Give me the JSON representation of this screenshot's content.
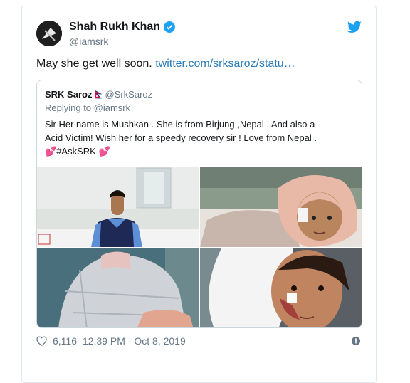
{
  "tweet": {
    "author_name": "Shah Rukh Khan",
    "author_handle": "@iamsrk",
    "text_prefix": "May she get well soon. ",
    "link_text": "twitter.com/srksaroz/statu…",
    "likes": "6,116",
    "timestamp": "12:39 PM - Oct 8, 2019",
    "icons": {
      "avatar": "profile-avatar",
      "verified": "verified-badge-icon",
      "brand": "twitter-bird-icon",
      "like": "heart-outline-icon",
      "info": "info-icon"
    },
    "colors": {
      "link": "#2b7bb9",
      "verified": "#1da1f2",
      "brand": "#1da1f2",
      "heart": "#e0245e"
    }
  },
  "quote": {
    "author_name": "SRK Saroz",
    "author_handle": "@SrkSaroz",
    "reply_prefix": "Replying to ",
    "reply_handle": "@iamsrk",
    "text_line1": "Sir Her name is Mushkan . She is from Birjung ,Nepal . And also a",
    "text_line2": "Acid Victim! Wish her for a speedy recovery sir !  Love from Nepal .",
    "heart1": "💕",
    "hashtag": "#AskSRK",
    "heart2": "💕",
    "icons": {
      "flag": "nepal-flag-icon"
    },
    "photos": [
      "man-in-vest-photo",
      "patient-lying-photo",
      "patient-shoulder-photo",
      "patient-face-photo"
    ]
  }
}
